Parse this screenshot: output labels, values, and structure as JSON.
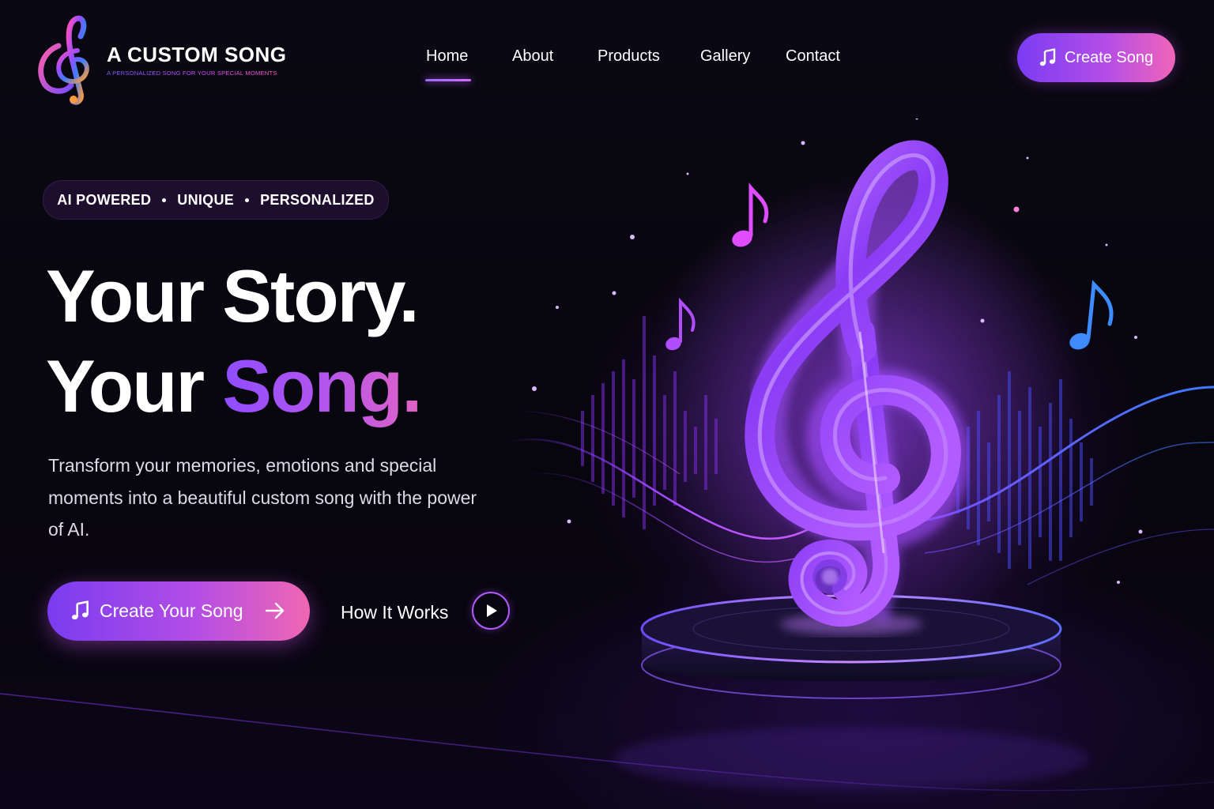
{
  "brand": {
    "name": "A CUSTOM SONG",
    "tagline": "A PERSONALIZED SONG FOR YOUR SPECIAL MOMENTS",
    "logo_icon": "treble-clef-icon"
  },
  "nav": {
    "items": [
      {
        "label": "Home",
        "active": true
      },
      {
        "label": "About",
        "active": false
      },
      {
        "label": "Products",
        "active": false
      },
      {
        "label": "Gallery",
        "active": false
      },
      {
        "label": "Contact",
        "active": false
      }
    ]
  },
  "header_cta": {
    "label": "Create Song",
    "icon": "music-note-icon"
  },
  "hero": {
    "badge": [
      "AI POWERED",
      "UNIQUE",
      "PERSONALIZED"
    ],
    "headline_line1": "Your Story.",
    "headline_line2_plain": "Your ",
    "headline_line2_accent": "Song.",
    "description": "Transform your memories, emotions and special moments into a beautiful custom song with the power of AI.",
    "primary_cta": {
      "label": "Create Your Song",
      "icon": "music-note-icon",
      "trailing_icon": "arrow-right-icon"
    },
    "secondary_cta": {
      "label": "How It Works",
      "icon": "play-icon"
    },
    "illustration": "glowing-treble-clef-on-pedestal"
  },
  "colors": {
    "background": "#07050d",
    "accent_purple": "#8f4dff",
    "accent_pink": "#f067b3",
    "accent_blue": "#3d7bff"
  }
}
